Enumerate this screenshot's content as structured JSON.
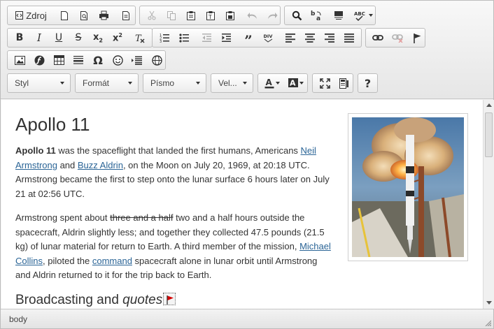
{
  "toolbar": {
    "source_label": "Zdroj",
    "combos": {
      "style": "Styl",
      "format": "Formát",
      "font": "Písmo",
      "size": "Vel..."
    },
    "help_label": "?"
  },
  "content": {
    "title": "Apollo 11",
    "p1": {
      "bold": "Apollo 11",
      "t1": " was the spaceflight that landed the first humans, Americans ",
      "link1": "Neil Armstrong",
      "t2": " and ",
      "link2": "Buzz Aldrin",
      "t3": ", on the Moon on July 20, 1969, at 20:18 UTC. Armstrong became the first to step onto the lunar surface 6 hours later on July 21 at 02:56 UTC."
    },
    "p2": {
      "t1": "Armstrong spent about ",
      "strike": "three and a half",
      "t2": " two and a half hours outside the spacecraft, Aldrin slightly less; and together they collected 47.5 pounds (21.5 kg) of lunar material for return to Earth. A third member of the mission, ",
      "link1": "Michael Collins",
      "t3": ", piloted the ",
      "link2": "command",
      "t4": " spacecraft alone in lunar orbit until Armstrong and Aldrin returned to it for the trip back to Earth."
    },
    "section": {
      "text": "Broadcasting and ",
      "em": "quotes"
    }
  },
  "statusbar": {
    "path": "body"
  },
  "colors": {
    "link": "#2a6496",
    "text": "#333333",
    "flag": "#d40000"
  }
}
